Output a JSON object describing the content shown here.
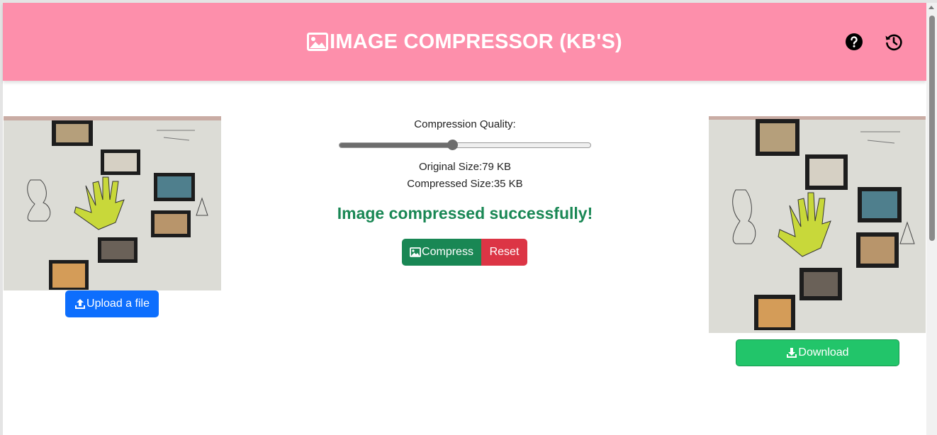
{
  "header": {
    "title": "IMAGE COMPRESSOR (KB'S)",
    "title_icon": "image-icon",
    "help_icon": "question-circle-icon",
    "history_icon": "history-icon",
    "background": "#fd8fab"
  },
  "left_panel": {
    "upload_label": "Upload a file",
    "upload_icon": "upload-icon"
  },
  "controls": {
    "quality_label": "Compression Quality:",
    "quality_value": 0.45,
    "original_size": "Original Size:79 KB",
    "compressed_size": "Compressed Size:35 KB",
    "status_message": "Image compressed successfully!",
    "compress_label": "Compress",
    "compress_icon": "image-icon",
    "reset_label": "Reset"
  },
  "right_panel": {
    "download_label": "Download",
    "download_icon": "download-icon"
  },
  "colors": {
    "header": "#fd8fab",
    "upload": "#0d6efd",
    "compress": "#198754",
    "reset": "#dc3545",
    "download": "#22c56a",
    "status": "#198754"
  }
}
